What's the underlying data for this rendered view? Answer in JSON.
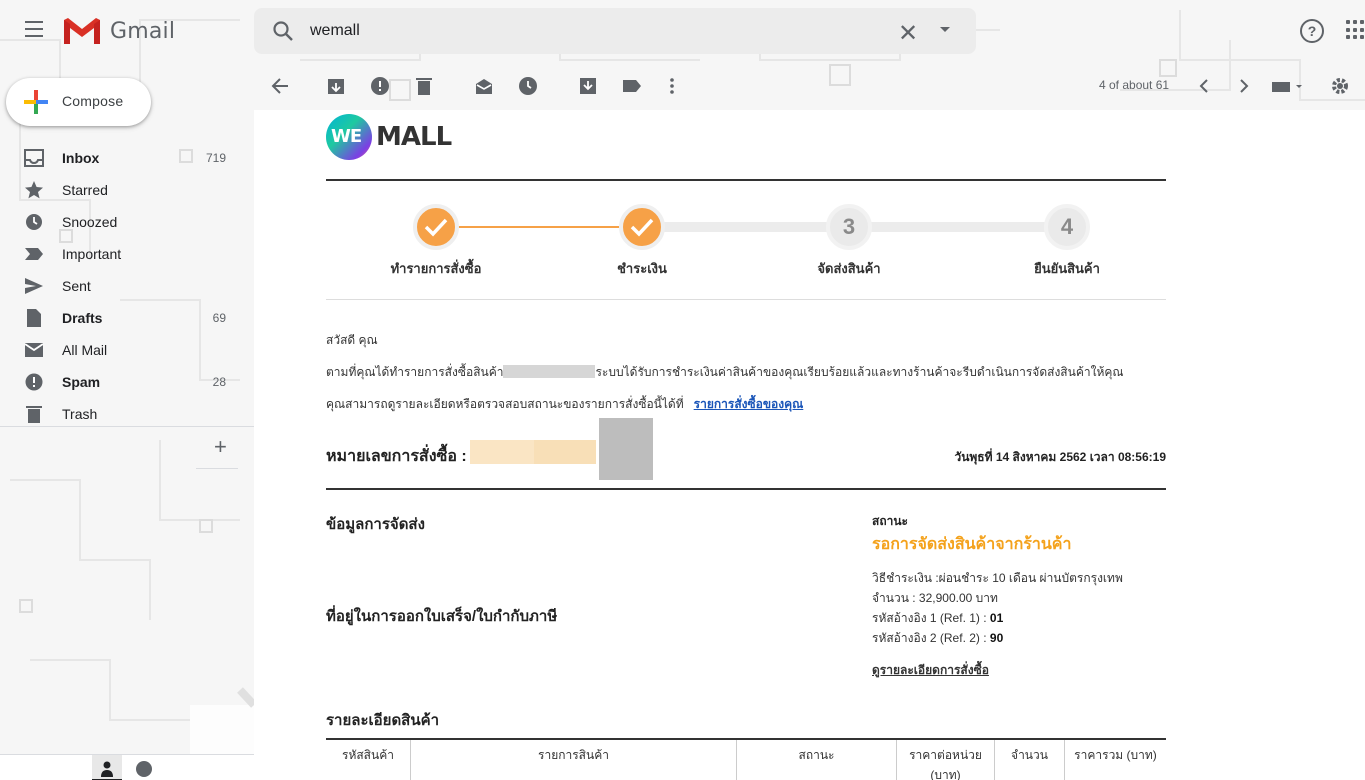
{
  "app": {
    "name": "Gmail"
  },
  "search": {
    "value": "wemall",
    "placeholder": "Search mail"
  },
  "compose": {
    "label": "Compose"
  },
  "sidebar": {
    "items": [
      {
        "label": "Inbox",
        "count": "719",
        "icon": "inbox-icon"
      },
      {
        "label": "Starred",
        "count": "",
        "icon": "star-icon"
      },
      {
        "label": "Snoozed",
        "count": "",
        "icon": "clock-icon"
      },
      {
        "label": "Important",
        "count": "",
        "icon": "important-icon"
      },
      {
        "label": "Sent",
        "count": "",
        "icon": "send-icon"
      },
      {
        "label": "Drafts",
        "count": "69",
        "icon": "draft-icon"
      },
      {
        "label": "All Mail",
        "count": "",
        "icon": "mail-icon"
      },
      {
        "label": "Spam",
        "count": "28",
        "icon": "spam-icon"
      },
      {
        "label": "Trash",
        "count": "",
        "icon": "trash-icon"
      }
    ],
    "add_label": "+"
  },
  "toolbar": {
    "paging": "4 of about 61",
    "icons": [
      "back-arrow-icon",
      "archive-icon",
      "report-spam-icon",
      "delete-icon",
      "mark-unread-icon",
      "snooze-icon",
      "move-to-icon",
      "labels-icon",
      "more-icon",
      "prev-icon",
      "next-icon",
      "keyboard-icon",
      "settings-icon"
    ]
  },
  "email": {
    "brand": {
      "part1": "WE",
      "part2": "MALL"
    },
    "steps": [
      {
        "label": "ทำรายการสั่งซื้อ",
        "state": "done",
        "number": "1"
      },
      {
        "label": "ชำระเงิน",
        "state": "done",
        "number": "2"
      },
      {
        "label": "จัดส่งสินค้า",
        "state": "todo",
        "number": "3"
      },
      {
        "label": "ยืนยันสินค้า",
        "state": "todo",
        "number": "4"
      }
    ],
    "greeting": "สวัสดี คุณ",
    "para1_a": "ตามที่คุณได้ทำรายการสั่งซื้อสินค้า",
    "para1_b": "ระบบได้รับการชำระเงินค่าสินค้าของคุณเรียบร้อยแล้วและทางร้านค้าจะรีบดำเนินการจัดส่งสินค้าให้คุณ",
    "para2": "คุณสามารถดูรายละเอียดหรือตรวจสอบสถานะของรายการสั่งซื้อนี้ได้ที่",
    "para2_link": "รายการสั่งซื้อของคุณ",
    "order_label": "หมายเลขการสั่งซื้อ :",
    "order_date": "วันพุธที่ 14 สิงหาคม 2562 เวลา 08:56:19",
    "shipping_title": "ข้อมูลการจัดส่ง",
    "invoice_title": "ที่อยู่ในการออกใบเสร็จ/ใบกำกับภาษี",
    "status_label": "สถานะ",
    "status_value": "รอการจัดส่งสินค้าจากร้านค้า",
    "payment_method": "วิธีชำระเงิน :ผ่อนชำระ 10 เดือน ผ่านบัตรกรุงเทพ",
    "amount": "จำนวน : 32,900.00 บาท",
    "ref1_label": "รหัสอ้างอิง 1 (Ref. 1) :",
    "ref1_value": "01",
    "ref2_label": "รหัสอ้างอิง 2 (Ref. 2) :",
    "ref2_value": "90",
    "order_detail_link": "ดูรายละเอียดการสั่งซื้อ",
    "product_title": "รายละเอียดสินค้า",
    "table_headers": [
      "รหัสสินค้า",
      "รายการสินค้า",
      "สถานะ",
      "ราคาต่อหน่วย (บาท)",
      "จำนวน",
      "ราคารวม (บาท)"
    ]
  },
  "colors": {
    "accent_orange": "#f6a147",
    "status_orange": "#f4a21c",
    "link_blue": "#1a55b8"
  }
}
